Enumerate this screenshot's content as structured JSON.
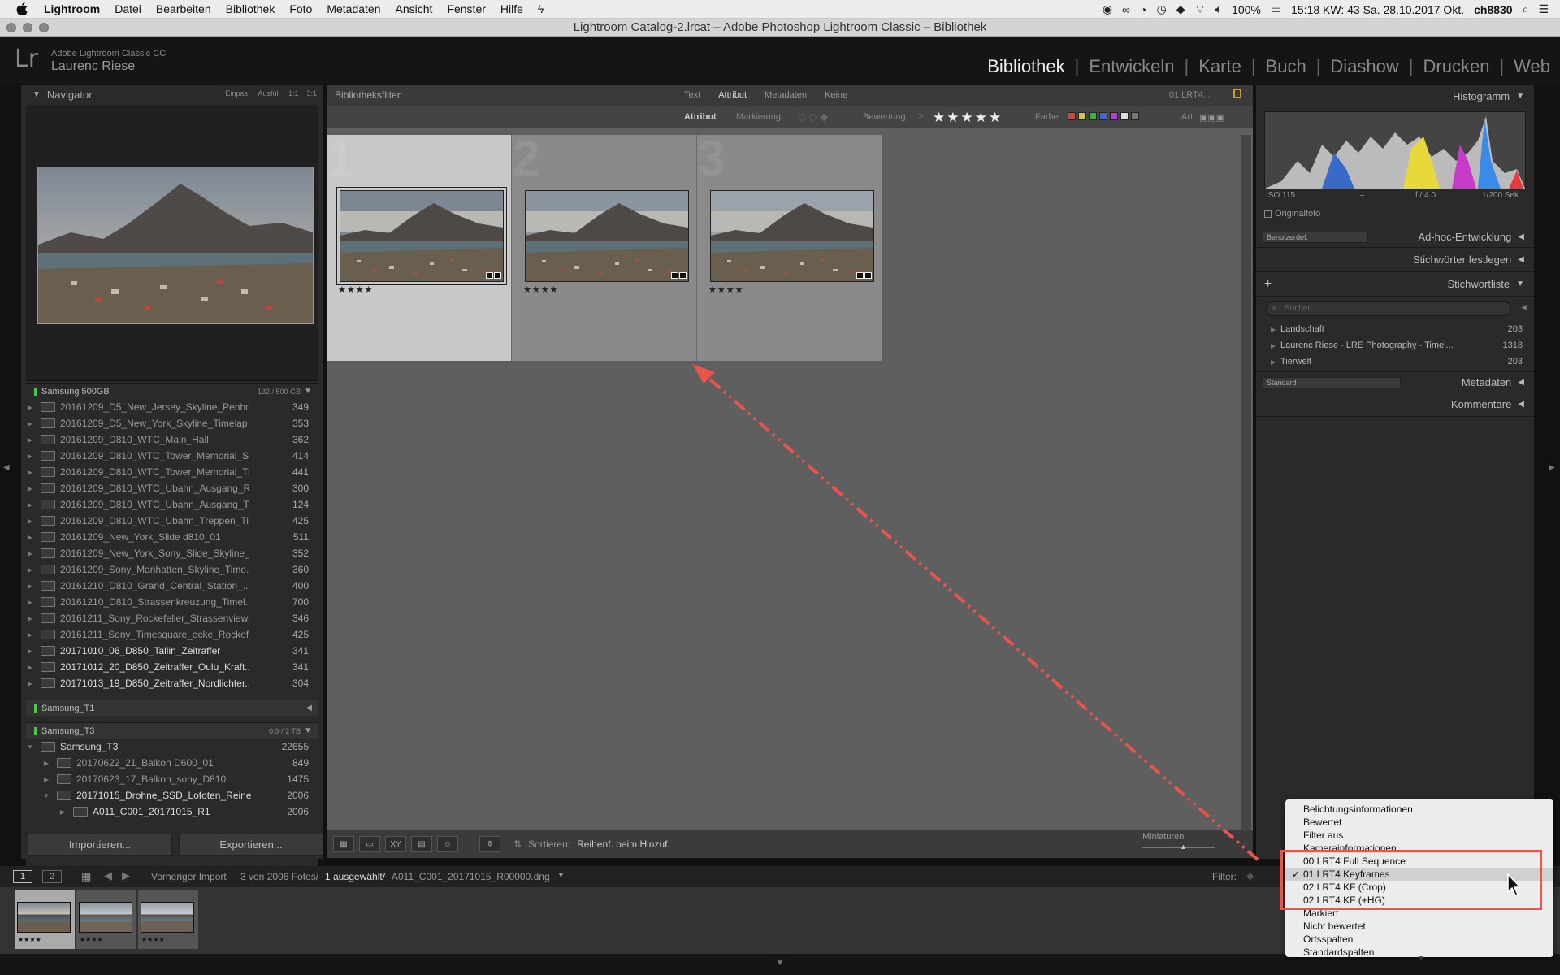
{
  "menubar": {
    "app": "Lightroom",
    "items": [
      "Datei",
      "Bearbeiten",
      "Bibliothek",
      "Foto",
      "Metadaten",
      "Ansicht",
      "Fenster",
      "Hilfe"
    ],
    "battery": "100%",
    "clock": "15:18 KW: 43 Sa. 28.10.2017 Okt.",
    "user": "ch8830"
  },
  "window": {
    "title": "Lightroom Catalog-2.lrcat – Adobe Photoshop Lightroom Classic – Bibliothek"
  },
  "identity": {
    "logo": "Lr",
    "product": "Adobe Lightroom Classic CC",
    "user": "Laurenc Riese"
  },
  "modules": {
    "items": [
      "Bibliothek",
      "Entwickeln",
      "Karte",
      "Buch",
      "Diashow",
      "Drucken",
      "Web"
    ],
    "active": "Bibliothek"
  },
  "navigator": {
    "title": "Navigator",
    "options": [
      "Einpas.",
      "Ausfül.",
      "1:1",
      "3:1"
    ]
  },
  "folders": {
    "volume1": {
      "name": "Samsung 500GB",
      "size": "132 / 500 GB"
    },
    "items": [
      {
        "name": "20161209_D5_New_Jersey_Skyline_Penho...",
        "count": "349"
      },
      {
        "name": "20161209_D5_New_York_Skyline_Timelap...",
        "count": "353"
      },
      {
        "name": "20161209_D810_WTC_Main_Hall",
        "count": "362"
      },
      {
        "name": "20161209_D810_WTC_Tower_Memorial_Sl...",
        "count": "414"
      },
      {
        "name": "20161209_D810_WTC_Tower_Memorial_Ti...",
        "count": "441"
      },
      {
        "name": "20161209_D810_WTC_Ubahn_Ausgang_R...",
        "count": "300"
      },
      {
        "name": "20161209_D810_WTC_Ubahn_Ausgang_T...",
        "count": "124"
      },
      {
        "name": "20161209_D810_WTC_Ubahn_Treppen_Ti...",
        "count": "425"
      },
      {
        "name": "20161209_New_York_Slide d810_01",
        "count": "511"
      },
      {
        "name": "20161209_New_York_Sony_Slide_Skyline_...",
        "count": "352"
      },
      {
        "name": "20161209_Sony_Manhatten_Skyline_Time...",
        "count": "360"
      },
      {
        "name": "20161210_D810_Grand_Central_Station_...",
        "count": "400"
      },
      {
        "name": "20161210_D810_Strassenkreuzung_Timel...",
        "count": "700"
      },
      {
        "name": "20161211_Sony_Rockefeller_Strassenview...",
        "count": "346"
      },
      {
        "name": "20161211_Sony_Timesquare_ecke_Rockef...",
        "count": "425"
      },
      {
        "name": "20171010_06_D850_Tallin_Zeitraffer",
        "count": "341"
      },
      {
        "name": "20171012_20_D850_Zeitraffer_Oulu_Kraft...",
        "count": "341"
      },
      {
        "name": "20171013_19_D850_Zeitraffer_Nordlichter...",
        "count": "304"
      }
    ],
    "volume2": {
      "name": "Samsung_T1"
    },
    "volume3": {
      "name": "Samsung_T3",
      "size": "0.9 / 2 TB"
    },
    "t3items": [
      {
        "name": "Samsung_T3",
        "count": "22655"
      },
      {
        "name": "20170622_21_Balkon D600_01",
        "count": "849"
      },
      {
        "name": "20170623_17_Balkon_sony_D810",
        "count": "1475"
      },
      {
        "name": "20171015_Drohne_SSD_Lofoten_Reine",
        "count": "2006"
      },
      {
        "name": "A011_C001_20171015_R1",
        "count": "2006"
      }
    ]
  },
  "buttons": {
    "import": "Importieren...",
    "export": "Exportieren..."
  },
  "libraryfilter": {
    "label": "Bibliotheksfilter:",
    "tabs": [
      "Text",
      "Attribut",
      "Metadaten",
      "Keine"
    ],
    "preset": "01 LRT4..."
  },
  "attribute": {
    "label": "Attribut",
    "flag": "Markierung",
    "rating": "Bewertung",
    "color": "Farbe",
    "kind": "Art",
    "stars": "★★★★★"
  },
  "grid": {
    "cells": [
      {
        "num": "1",
        "stars": "★★★★"
      },
      {
        "num": "2",
        "stars": "★★★★"
      },
      {
        "num": "3",
        "stars": "★★★★"
      }
    ]
  },
  "toolbar": {
    "sort_label": "Sortieren:",
    "sort_value": "Reihenf. beim Hinzuf.",
    "thumbs": "Miniaturen"
  },
  "rightpanel": {
    "histogram": "Histogramm",
    "iso": "ISO 115",
    "dash": "–",
    "aperture": "f / 4.0",
    "shutter": "1/200 Sek.",
    "original": "Originalfoto",
    "quickdev_sel": "Benutzerdef.",
    "quickdev": "Ad-hoc-Entwicklung",
    "keywording": "Stichwörter festlegen",
    "keywordlist": "Stichwortliste",
    "search_placeholder": "Suchen",
    "keywords": [
      {
        "name": "Landschaft",
        "count": "203"
      },
      {
        "name": "Laurenc Riese - LRE Photography - Timel...",
        "count": "1318"
      },
      {
        "name": "Tierwelt",
        "count": "203"
      }
    ],
    "meta_sel": "Standard",
    "metadata": "Metadaten",
    "comments": "Kommentare"
  },
  "filmstrip": {
    "pages": [
      "1",
      "2"
    ],
    "source": "Vorheriger Import",
    "count": "3 von 2006 Fotos/",
    "selected": "1 ausgewählt/",
    "file": "A011_C001_20171015_R00000.dng",
    "filter": "Filter:",
    "stars": "★★★★"
  },
  "dropdown": {
    "items": [
      "Belichtungsinformationen",
      "Bewertet",
      "Filter aus",
      "Kamerainformationen",
      "00 LRT4 Full Sequence",
      "01 LRT4 Keyframes",
      "02 LRT4 KF (Crop)",
      "02 LRT4 KF (+HG)",
      "Markiert",
      "Nicht bewertet",
      "Ortsspalten",
      "Standardspalten"
    ],
    "checked": "01 LRT4 Keyframes"
  },
  "colors": {
    "accent_arrow": "#e8554a",
    "background": "#5f5f5f"
  }
}
